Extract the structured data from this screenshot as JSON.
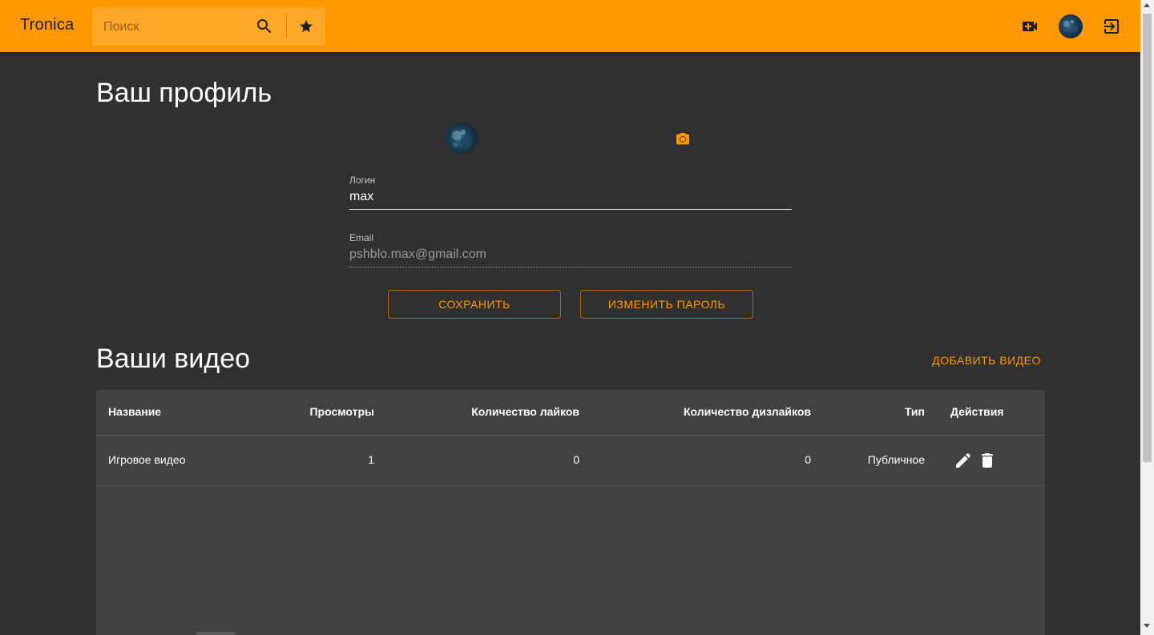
{
  "header": {
    "brand": "Tronica",
    "search_placeholder": "Поиск"
  },
  "profile": {
    "title": "Ваш профиль",
    "login_label": "Логин",
    "login_value": "max",
    "email_label": "Email",
    "email_value": "pshblo.max@gmail.com",
    "save_label": "СОХРАНИТЬ",
    "change_password_label": "ИЗМЕНИТЬ ПАРОЛЬ"
  },
  "videos": {
    "title": "Ваши видео",
    "add_label": "ДОБАВИТЬ ВИДЕО",
    "columns": [
      "Название",
      "Просмотры",
      "Количество лайков",
      "Количество дизлайков",
      "Тип",
      "Действия"
    ],
    "rows": [
      {
        "name": "Игровое видео",
        "views": "1",
        "likes": "0",
        "dislikes": "0",
        "type": "Публичное"
      }
    ]
  },
  "colors": {
    "accent": "#ff9800",
    "background": "#303030",
    "card": "#424242"
  },
  "icons": {
    "search": "search-icon",
    "favorites": "star-icon",
    "add_video": "video-camera-add-icon",
    "logout": "logout-icon",
    "change_photo": "camera-icon",
    "edit": "pencil-icon",
    "delete": "trash-icon"
  }
}
